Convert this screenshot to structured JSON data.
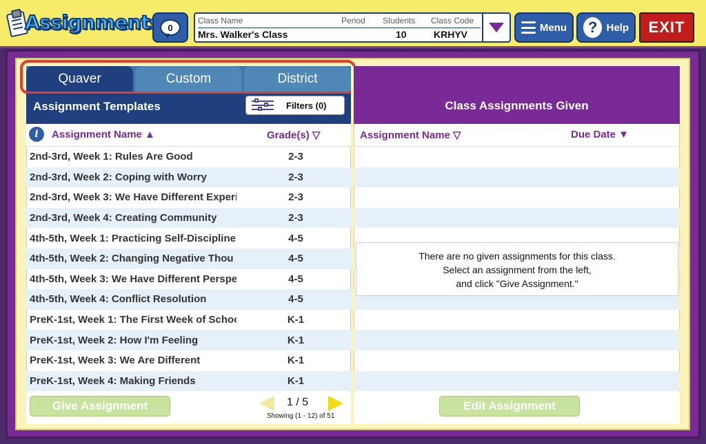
{
  "header": {
    "logo_text": "Assignments",
    "message_count": "0",
    "class_info": {
      "labels": {
        "class_name": "Class Name",
        "period": "Period",
        "students": "Students",
        "class_code": "Class Code"
      },
      "values": {
        "class_name": "Mrs. Walker's Class",
        "period": "",
        "students": "10",
        "class_code": "KRHYV"
      }
    },
    "menu_label": "Menu",
    "help_label": "Help",
    "exit_label": "EXIT"
  },
  "left": {
    "tabs": [
      {
        "label": "Quaver",
        "selected": true
      },
      {
        "label": "Custom",
        "selected": false
      },
      {
        "label": "District",
        "selected": false
      }
    ],
    "panel_title": "Assignment Templates",
    "filters_label": "Filters (0)",
    "columns": {
      "name": "Assignment Name ▲",
      "grade": "Grade(s) ▽"
    },
    "rows": [
      {
        "name": "2nd-3rd, Week 1: Rules Are Good",
        "grade": "2-3"
      },
      {
        "name": "2nd-3rd, Week 2: Coping with Worry",
        "grade": "2-3"
      },
      {
        "name": "2nd-3rd, Week 3: We Have Different Experi",
        "grade": "2-3"
      },
      {
        "name": "2nd-3rd, Week 4: Creating Community",
        "grade": "2-3"
      },
      {
        "name": "4th-5th, Week 1: Practicing Self-Discipline",
        "grade": "4-5"
      },
      {
        "name": "4th-5th, Week 2: Changing Negative Thou",
        "grade": "4-5"
      },
      {
        "name": "4th-5th, Week 3: We Have Different Perspe",
        "grade": "4-5"
      },
      {
        "name": "4th-5th, Week 4: Conflict Resolution",
        "grade": "4-5"
      },
      {
        "name": "PreK-1st, Week 1: The First Week of Schoo",
        "grade": "K-1"
      },
      {
        "name": "PreK-1st, Week 2: How I'm Feeling",
        "grade": "K-1"
      },
      {
        "name": "PreK-1st, Week 3: We Are Different",
        "grade": "K-1"
      },
      {
        "name": "PreK-1st, Week 4: Making Friends",
        "grade": "K-1"
      }
    ],
    "give_button": "Give Assignment",
    "page": "1 / 5",
    "showing": "Showing (1 - 12) of 51"
  },
  "right": {
    "panel_title": "Class Assignments Given",
    "columns": {
      "name": "Assignment Name ▽",
      "due": "Due Date ▼"
    },
    "empty_lines": [
      "There are no given assignments for this class.",
      "Select an assignment from the left,",
      "and click \"Give Assignment.\""
    ],
    "edit_button": "Edit Assignment"
  }
}
